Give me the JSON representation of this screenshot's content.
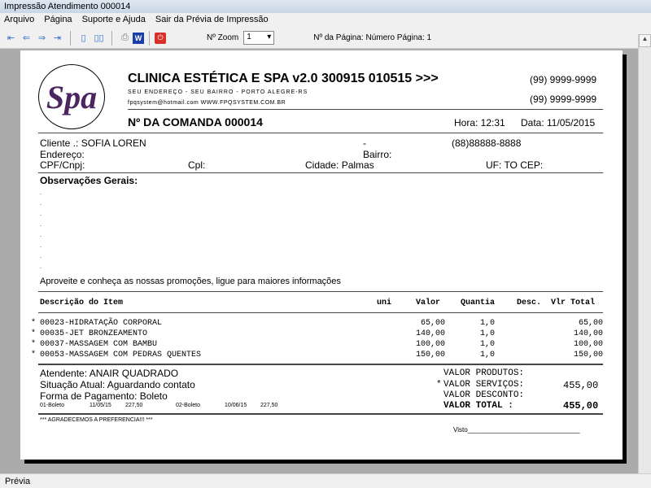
{
  "window": {
    "title": "Impressão Atendimento 000014"
  },
  "menu": [
    "Arquivo",
    "Página",
    "Suporte e Ajuda",
    "Sair da Prévia de Impressão"
  ],
  "toolbar": {
    "zoom_label": "Nº Zoom",
    "zoom_value": "1",
    "page_label": "Nº da Página: Número Página: 1"
  },
  "status": "Prévia",
  "doc": {
    "company": "CLINICA ESTÉTICA E SPA v2.0 300915 010515 >>>",
    "address": "SEU ENDEREÇO - SEU BAIRRO - PORTO ALEGRE-RS",
    "contact": "fpqsystem@hotmail.com  WWW.FPQSYSTEM.COM.BR",
    "phone1": "(99) 9999-9999",
    "phone2": "(99) 9999-9999",
    "logo_text": "spa",
    "comanda": "Nº DA COMANDA 000014",
    "hora": "Hora: 12:31",
    "data": "Data: 11/05/2015",
    "cliente": "Cliente   .: SOFIA LOREN",
    "dash": "-",
    "cliente_phone": "(88)88888-8888",
    "endereco": "Endereço:",
    "bairro": "Bairro:",
    "cpf": "CPF/Cnpj:",
    "cpl": "Cpl:",
    "cidade": "Cidade: Palmas",
    "uf": "UF: TO CEP:",
    "obs_title": "Observações Gerais:",
    "promo": "Aproveite e conheça as nossas promoções, ligue para maiores informações",
    "headers": [
      "Descrição do Item",
      "uni",
      "Valor",
      "Quantia",
      "Desc.",
      "Vlr Total"
    ],
    "items": [
      {
        "mark": "*",
        "desc": "00023-HIDRATAÇÃO CORPORAL",
        "valor": "65,00",
        "qtd": "1,0",
        "total": "65,00"
      },
      {
        "mark": "*",
        "desc": "00035-JET BRONZEAMENTO",
        "valor": "140,00",
        "qtd": "1,0",
        "total": "140,00"
      },
      {
        "mark": "*",
        "desc": "00037-MASSAGEM COM BAMBU",
        "valor": "100,00",
        "qtd": "1,0",
        "total": "100,00"
      },
      {
        "mark": "*",
        "desc": "00053-MASSAGEM COM PEDRAS QUENTES",
        "valor": "150,00",
        "qtd": "1,0",
        "total": "150,00"
      }
    ],
    "atendente": "Atendente: ANAIR QUADRADO",
    "situacao": "Situação Atual: Aguardando contato",
    "pagamento": "Forma de Pagamento: Boleto",
    "parcelas": [
      "01-Boleto",
      "11/05/15",
      "227,50",
      "02-Boleto",
      "10/06/15",
      "227,50"
    ],
    "vprod": "VALOR PRODUTOS:",
    "vserv_mark": "*",
    "vserv": "VALOR SERVIÇOS:",
    "vserv_val": "455,00",
    "vdesc": "VALOR DESCONTO:",
    "vtotal": "VALOR TOTAL   :",
    "vtotal_val": "455,00",
    "agradece": "*** AGRADECEMOS A PREFERENCIA!!! ***",
    "visto": "Visto_______________________________"
  }
}
